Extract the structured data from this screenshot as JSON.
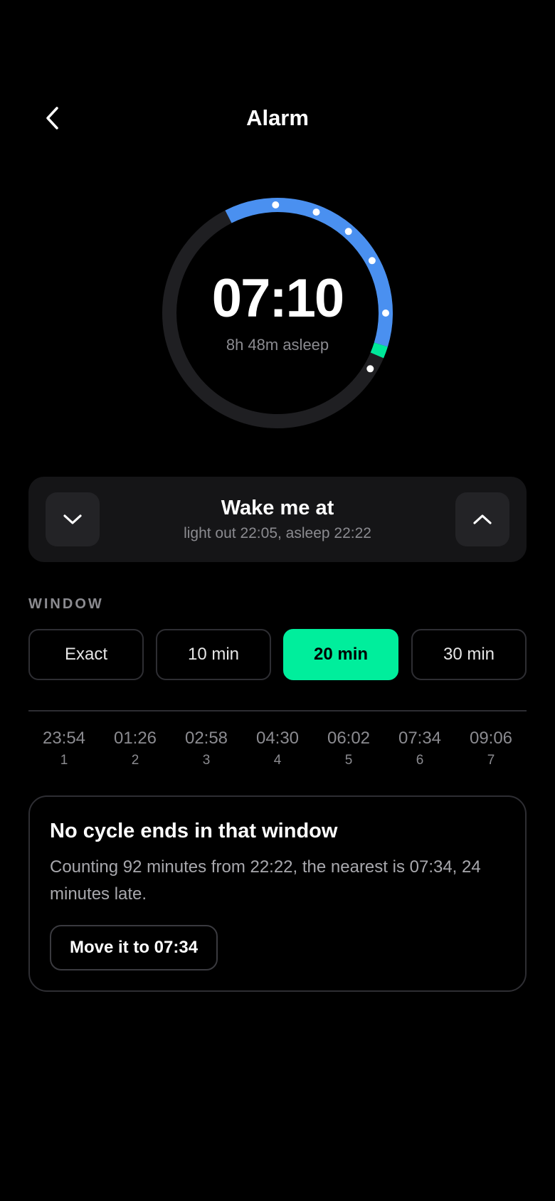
{
  "header": {
    "title": "Alarm",
    "back_icon": "chevron-left-icon"
  },
  "dial": {
    "time": "07:10",
    "subtitle": "8h 48m asleep",
    "colors": {
      "track": "#1f1f22",
      "sleep_arc": "#4a90f0",
      "window": "#00e89a",
      "dot": "#ffffff"
    }
  },
  "wake": {
    "title": "Wake me at",
    "subtitle": "light out 22:05, asleep 22:22",
    "down_icon": "chevron-down-icon",
    "up_icon": "chevron-up-icon"
  },
  "window": {
    "label": "WINDOW",
    "options": [
      "Exact",
      "10 min",
      "20 min",
      "30 min"
    ],
    "selected": "20 min",
    "accent": "#00ee9c"
  },
  "cycles": [
    {
      "time": "23:54",
      "num": "1"
    },
    {
      "time": "01:26",
      "num": "2"
    },
    {
      "time": "02:58",
      "num": "3"
    },
    {
      "time": "04:30",
      "num": "4"
    },
    {
      "time": "06:02",
      "num": "5"
    },
    {
      "time": "07:34",
      "num": "6"
    },
    {
      "time": "09:06",
      "num": "7"
    }
  ],
  "notice": {
    "title": "No cycle ends in that window",
    "body": "Counting 92 minutes from 22:22, the nearest is 07:34, 24 minutes late.",
    "button": "Move it to 07:34"
  }
}
